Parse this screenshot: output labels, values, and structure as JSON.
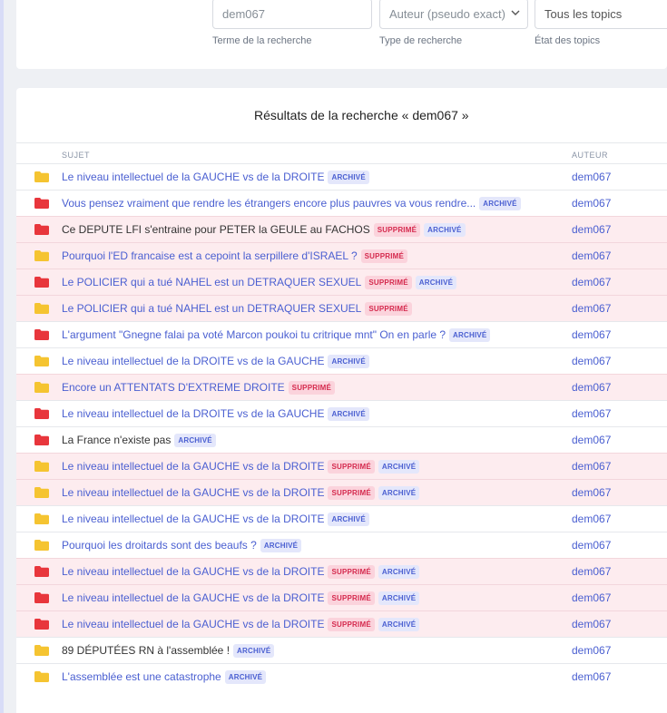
{
  "search": {
    "term_value": "dem067",
    "term_caption": "Terme de la recherche",
    "type_value": "Auteur (pseudo exact)",
    "type_caption": "Type de recherche",
    "state_value": "Tous les topics",
    "state_caption": "État des topics"
  },
  "results": {
    "title": "Résultats de la recherche « dem067 »",
    "col_subject": "SUJET",
    "col_author": "AUTEUR",
    "badge_supp": "SUPPRIMÉ",
    "badge_arch": "ARCHIVÉ",
    "colors": {
      "folder_yellow": "#f5c431",
      "folder_red": "#e8363c",
      "link": "#4a5fd1",
      "deleted_bg": "#fdecef"
    },
    "rows": [
      {
        "title": "Le niveau intellectuel de la GAUCHE vs de la DROITE",
        "folder": "yellow",
        "supp": false,
        "arch": true,
        "link": true,
        "author": "dem067"
      },
      {
        "title": "Vous pensez vraiment que rendre les étrangers encore plus pauvres va vous rendre...",
        "folder": "red",
        "supp": false,
        "arch": true,
        "link": true,
        "author": "dem067"
      },
      {
        "title": "Ce DEPUTE LFI s'entraine pour PETER la GEULE au FACHOS",
        "folder": "red",
        "supp": true,
        "arch": true,
        "link": false,
        "author": "dem067"
      },
      {
        "title": "Pourquoi l'ED francaise est a cepoint la serpillere d'ISRAEL ?",
        "folder": "yellow",
        "supp": true,
        "arch": false,
        "link": true,
        "author": "dem067"
      },
      {
        "title": "Le POLICIER qui a tué NAHEL est un DETRAQUER SEXUEL",
        "folder": "red",
        "supp": true,
        "arch": true,
        "link": true,
        "author": "dem067"
      },
      {
        "title": "Le POLICIER qui a tué NAHEL est un DETRAQUER SEXUEL",
        "folder": "yellow",
        "supp": true,
        "arch": false,
        "link": true,
        "author": "dem067"
      },
      {
        "title": "L'argument \"Gnegne falai pa voté Marcon poukoi tu critrique mnt\" On en parle ?",
        "folder": "red",
        "supp": false,
        "arch": true,
        "link": true,
        "author": "dem067"
      },
      {
        "title": "Le niveau intellectuel de la DROITE vs de la GAUCHE",
        "folder": "yellow",
        "supp": false,
        "arch": true,
        "link": true,
        "author": "dem067"
      },
      {
        "title": "Encore un ATTENTATS D'EXTREME DROITE",
        "folder": "yellow",
        "supp": true,
        "arch": false,
        "link": true,
        "author": "dem067"
      },
      {
        "title": "Le niveau intellectuel de la DROITE vs de la GAUCHE",
        "folder": "red",
        "supp": false,
        "arch": true,
        "link": true,
        "author": "dem067"
      },
      {
        "title": "La France n'existe pas",
        "folder": "red",
        "supp": false,
        "arch": true,
        "link": false,
        "author": "dem067"
      },
      {
        "title": "Le niveau intellectuel de la GAUCHE vs de la DROITE",
        "folder": "yellow",
        "supp": true,
        "arch": true,
        "link": true,
        "author": "dem067"
      },
      {
        "title": "Le niveau intellectuel de la GAUCHE vs de la DROITE",
        "folder": "yellow",
        "supp": true,
        "arch": true,
        "link": true,
        "author": "dem067"
      },
      {
        "title": "Le niveau intellectuel de la GAUCHE vs de la DROITE",
        "folder": "yellow",
        "supp": false,
        "arch": true,
        "link": true,
        "author": "dem067"
      },
      {
        "title": "Pourquoi les droitards sont des beaufs ?",
        "folder": "yellow",
        "supp": false,
        "arch": true,
        "link": true,
        "author": "dem067"
      },
      {
        "title": "Le niveau intellectuel de la GAUCHE vs de la DROITE",
        "folder": "red",
        "supp": true,
        "arch": true,
        "link": true,
        "author": "dem067"
      },
      {
        "title": "Le niveau intellectuel de la GAUCHE vs de la DROITE",
        "folder": "red",
        "supp": true,
        "arch": true,
        "link": true,
        "author": "dem067"
      },
      {
        "title": "Le niveau intellectuel de la GAUCHE vs de la DROITE",
        "folder": "red",
        "supp": true,
        "arch": true,
        "link": true,
        "author": "dem067"
      },
      {
        "title": "89 DÉPUTÉES RN à l'assemblée !",
        "folder": "yellow",
        "supp": false,
        "arch": true,
        "link": false,
        "author": "dem067"
      },
      {
        "title": "L'assemblée est une catastrophe",
        "folder": "yellow",
        "supp": false,
        "arch": true,
        "link": true,
        "author": "dem067"
      }
    ]
  }
}
